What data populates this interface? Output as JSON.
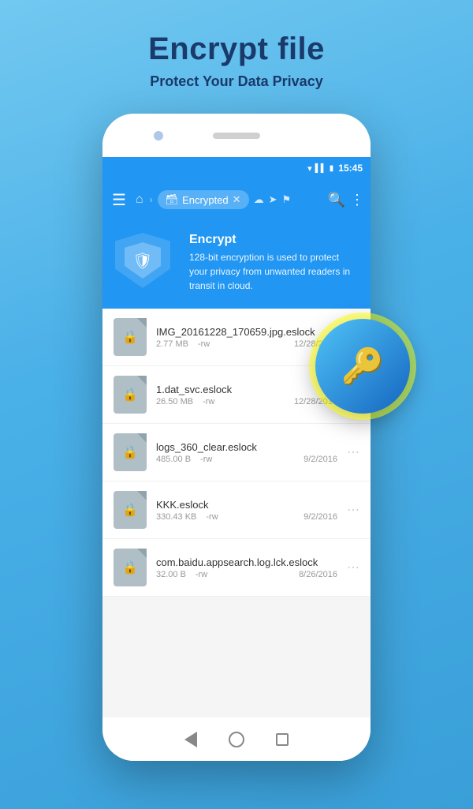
{
  "page": {
    "title": "Encrypt file",
    "subtitle": "Protect Your Data Privacy"
  },
  "statusBar": {
    "time": "15:45",
    "icons": [
      "wifi",
      "signal",
      "battery"
    ]
  },
  "appBar": {
    "hamburger": "☰",
    "home": "🏠",
    "breadcrumb": {
      "label": "Encrypted",
      "icon": "🗃"
    },
    "actions": [
      "cloud",
      "send",
      "bookmark"
    ],
    "search": "🔍",
    "more": "⋮"
  },
  "encryptBanner": {
    "title": "Encrypt",
    "description": "128-bit encryption is used to protect your privacy from unwanted readers in transit in cloud."
  },
  "files": [
    {
      "name": "IMG_20161228_170659.jpg.eslock",
      "size": "2.77 MB",
      "perm": "-rw",
      "date": "12/28/2016"
    },
    {
      "name": "1.dat_svc.eslock",
      "size": "26.50 MB",
      "perm": "-rw",
      "date": "12/28/2016"
    },
    {
      "name": "logs_360_clear.eslock",
      "size": "485.00 B",
      "perm": "-rw",
      "date": "9/2/2016"
    },
    {
      "name": "KKK.eslock",
      "size": "330.43 KB",
      "perm": "-rw",
      "date": "9/2/2016"
    },
    {
      "name": "com.baidu.appsearch.log.lck.eslock",
      "size": "32.00 B",
      "perm": "-rw",
      "date": "8/26/2016"
    }
  ],
  "floatingButton": {
    "icon": "🔑"
  }
}
